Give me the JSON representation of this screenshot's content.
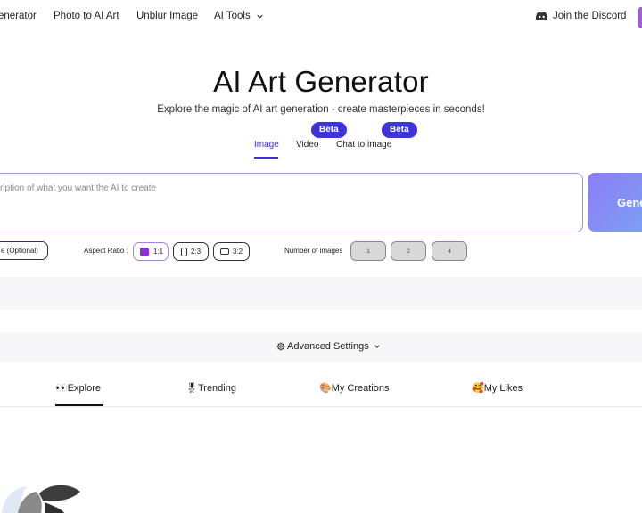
{
  "nav": {
    "items": [
      {
        "label": "enerator"
      },
      {
        "label": "Photo to AI Art"
      },
      {
        "label": "Unblur Image"
      },
      {
        "label": "AI Tools"
      }
    ],
    "discord_label": "Join the Discord"
  },
  "hero": {
    "title": "AI Art Generator",
    "subtitle": "Explore the magic of AI art generation - create masterpieces in seconds!"
  },
  "mode_tabs": [
    {
      "label": "Image",
      "active": true,
      "badge": ""
    },
    {
      "label": "Video",
      "active": false,
      "badge": "Beta"
    },
    {
      "label": "Chat to image",
      "active": false,
      "badge": "Beta"
    }
  ],
  "prompt": {
    "placeholder": "ription of what you want the AI to create",
    "generate_label": "Gene"
  },
  "options": {
    "style_label": "e (Optional)",
    "aspect_ratio_label": "Aspect Ratio :",
    "aspect_ratios": [
      {
        "label": "1:1",
        "selected": true,
        "icon": "square-filled-icon"
      },
      {
        "label": "2:3",
        "selected": false,
        "icon": "portrait-rect-icon"
      },
      {
        "label": "3:2",
        "selected": false,
        "icon": "landscape-rect-icon"
      }
    ],
    "num_images_label": "Number of images",
    "num_images": [
      "1",
      "2",
      "4"
    ]
  },
  "advanced_settings_label": "Advanced Settings",
  "feed_tabs": [
    {
      "emoji": "👀",
      "label": "Explore",
      "active": true
    },
    {
      "emoji": "🎖",
      "label": "Trending",
      "active": false
    },
    {
      "emoji": "🎨",
      "label": "My Creations",
      "active": false
    },
    {
      "emoji": "🥰",
      "label": "My Likes",
      "active": false
    }
  ],
  "colors": {
    "accent": "#3d34d9",
    "selected_border": "#b07fdd",
    "selected_fill": "#8d2fd9",
    "generate_gradient_start": "#8c7df6",
    "generate_gradient_end": "#7aa6f4"
  }
}
